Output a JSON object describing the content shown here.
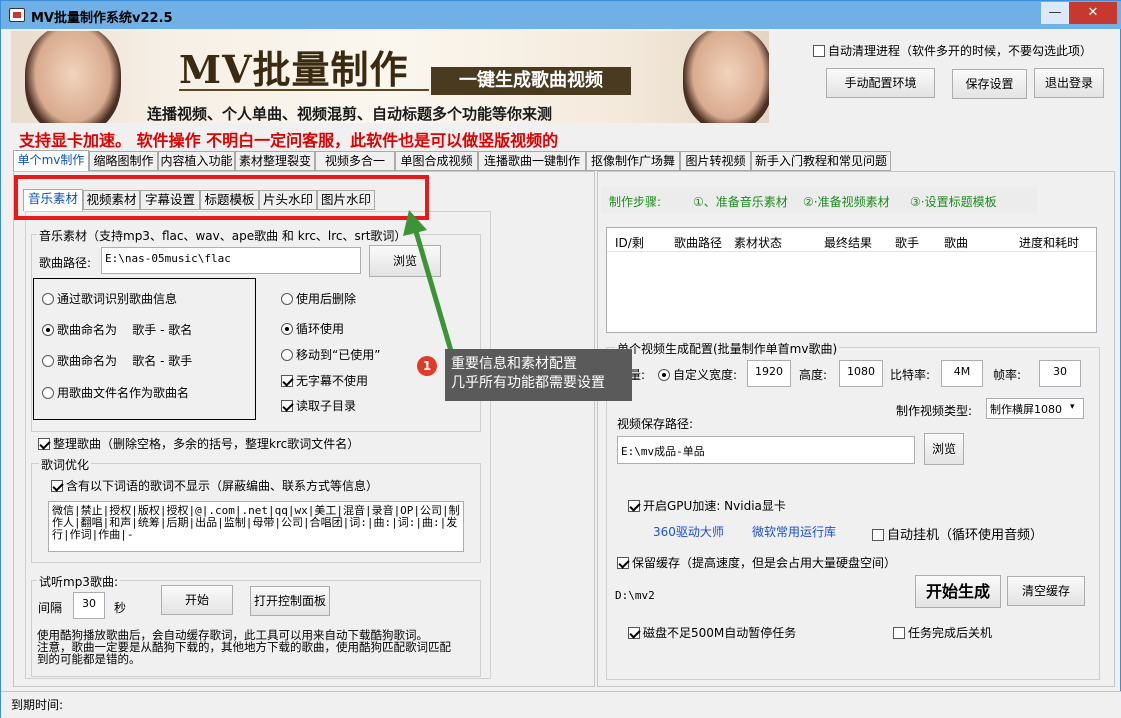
{
  "window": {
    "title": "MV批量制作系统v22.5",
    "min": "—",
    "max": "□",
    "close": "✕"
  },
  "banner": {
    "title": "MV批量制作",
    "badge": "一键生成歌曲视频",
    "subtitle": "连播视频、个人单曲、视频混剪、自动标题多个功能等你来测"
  },
  "top_right": {
    "auto_clean_label": "自动清理进程（软件多开的时候，不要勾选此项）",
    "auto_clean_checked": false,
    "config_env": "手动配置环境",
    "save_config": "保存设置",
    "logout": "退出登录"
  },
  "notice": "支持显卡加速。 软件操作 不明白一定问客服，此软件也是可以做竖版视频的",
  "main_tabs": [
    "单个mv制作",
    "缩略图制作",
    "内容植入功能",
    "素材整理裂变",
    "视频多合一",
    "单图合成视频",
    "连播歌曲一键制作",
    "抠像制作广场舞",
    "图片转视频",
    "新手入门教程和常见问题"
  ],
  "sub_tabs": [
    "音乐素材",
    "视频素材",
    "字幕设置",
    "标题模板",
    "片头水印",
    "图片水印"
  ],
  "music": {
    "group_label": "音乐素材（支持mp3、flac、wav、ape歌曲 和 krc、lrc、srt歌词）",
    "path_label": "歌曲路径:",
    "path_value": "E:\\nas-05music\\flac",
    "browse": "浏览",
    "radios": [
      {
        "label": "通过歌词识别歌曲信息",
        "on": false
      },
      {
        "label": "歌曲命名为    歌手 - 歌名",
        "on": true
      },
      {
        "label": "歌曲命名为    歌名 - 歌手",
        "on": false
      },
      {
        "label": "用歌曲文件名作为歌曲名",
        "on": false
      }
    ],
    "options": [
      {
        "label": "使用后删除",
        "type": "radio",
        "on": false
      },
      {
        "label": "循环使用",
        "type": "radio",
        "on": true
      },
      {
        "label": "移动到“已使用”",
        "type": "radio",
        "on": false
      },
      {
        "label": "无字幕不使用",
        "type": "check",
        "on": true
      },
      {
        "label": "读取子目录",
        "type": "check",
        "on": true
      }
    ],
    "tidy_label": "整理歌曲（删除空格，多余的括号，整理krc歌词文件名）",
    "tidy_checked": true
  },
  "lyrics": {
    "group_label": "歌词优化",
    "hide_label": "含有以下词语的歌词不显示（屏蔽编曲、联系方式等信息）",
    "hide_checked": true,
    "words": "微信|禁止|授权|版权|授权|@|.com|.net|qq|wx|美工|混音|录音|OP|公司|制作人|翻唱|和声|统筹|后期|出品|监制|母带|公司|合唱团|词:|曲:|词:|曲:|发行|作词|作曲|-"
  },
  "trial": {
    "group_label": "试听mp3歌曲:",
    "interval_label": "间隔",
    "interval_value": "30",
    "seconds": "秒",
    "start": "开始",
    "open_panel": "打开控制面板",
    "help1": "使用酷狗播放歌曲后，会自动缓存歌词，此工具可以用来自动下载酷狗歌词。",
    "help2": "注意，歌曲一定要是从酷狗下载的，其他地方下载的歌曲，使用酷狗匹配歌词匹配",
    "help3": "到的可能都是错的。"
  },
  "steps": {
    "label": "制作步骤:",
    "s1": "①、准备音乐素材",
    "s2": "②·准备视频素材",
    "s3": "③·设置标题模板"
  },
  "table": {
    "columns": [
      "ID/剩",
      "歌曲路径",
      "素材状态",
      "最终结果",
      "歌手",
      "歌曲",
      "进度和耗时"
    ]
  },
  "config": {
    "group_label": "单个视频生成配置(批量制作单首mv歌曲)",
    "quality_label": "质量:",
    "custom_width_label": "自定义宽度:",
    "width": "1920",
    "height_label": "高度:",
    "height": "1080",
    "bitrate_label": "比特率:",
    "bitrate": "4M",
    "fps_label": "帧率:",
    "fps": "30",
    "type_label": "制作视频类型:",
    "type_value": "制作横屏1080",
    "save_path_label": "视频保存路径:",
    "save_path": "E:\\mv成品-单品",
    "browse": "浏览",
    "gpu_label": "开启GPU加速: Nvidia显卡",
    "gpu_checked": true,
    "link1": "360驱动大师",
    "link2": "微软常用运行库",
    "auto_hang_label": "自动挂机（循环使用音频）",
    "auto_hang_checked": false,
    "cache_label": "保留缓存（提高速度，但是会占用大量硬盘空间）",
    "cache_checked": true,
    "cache_path": "D:\\mv2",
    "generate": "开始生成",
    "clear_cache": "清空缓存",
    "disk_label": "磁盘不足500M自动暂停任务",
    "disk_checked": true,
    "shutdown_label": "任务完成后关机",
    "shutdown_checked": false
  },
  "annotation": {
    "number": "1",
    "line1": "重要信息和素材配置",
    "line2": "几乎所有功能都需要设置"
  },
  "status": {
    "expire_label": "到期时间:"
  }
}
